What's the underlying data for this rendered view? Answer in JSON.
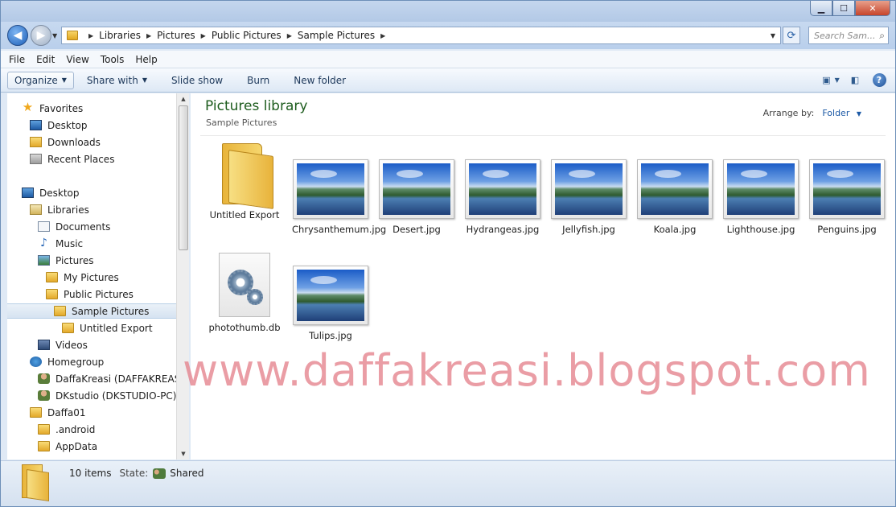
{
  "addressbar": {
    "breadcrumbs": [
      "Libraries",
      "Pictures",
      "Public Pictures",
      "Sample Pictures"
    ],
    "search_placeholder": "Search Sam..."
  },
  "menu": [
    "File",
    "Edit",
    "View",
    "Tools",
    "Help"
  ],
  "toolbar": {
    "organize": "Organize",
    "share_with": "Share with",
    "slide_show": "Slide show",
    "burn": "Burn",
    "new_folder": "New folder"
  },
  "nav": {
    "favorites": "Favorites",
    "desktop_fav": "Desktop",
    "downloads": "Downloads",
    "recent_places": "Recent Places",
    "desktop": "Desktop",
    "libraries": "Libraries",
    "documents": "Documents",
    "music": "Music",
    "pictures": "Pictures",
    "my_pictures": "My Pictures",
    "public_pictures": "Public Pictures",
    "sample_pictures": "Sample Pictures",
    "untitled_export": "Untitled Export",
    "videos": "Videos",
    "homegroup": "Homegroup",
    "user1": "DaffaKreasi (DAFFAKREASI-P",
    "user2": "DKstudio (DKSTUDIO-PC)",
    "daffa01": "Daffa01",
    "android": ".android",
    "appdata": "AppData"
  },
  "content": {
    "library_title": "Pictures library",
    "library_subtitle": "Sample Pictures",
    "arrange_by_label": "Arrange by:",
    "arrange_by_value": "Folder",
    "items": [
      {
        "name": "Untitled Export",
        "type": "folder"
      },
      {
        "name": "Chrysanthemum.jpg",
        "type": "image"
      },
      {
        "name": "Desert.jpg",
        "type": "image"
      },
      {
        "name": "Hydrangeas.jpg",
        "type": "image"
      },
      {
        "name": "Jellyfish.jpg",
        "type": "image"
      },
      {
        "name": "Koala.jpg",
        "type": "image"
      },
      {
        "name": "Lighthouse.jpg",
        "type": "image"
      },
      {
        "name": "Penguins.jpg",
        "type": "image"
      },
      {
        "name": "photothumb.db",
        "type": "file"
      },
      {
        "name": "Tulips.jpg",
        "type": "image"
      }
    ]
  },
  "watermark": "www.daffakreasi.blogspot.com",
  "statusbar": {
    "count": "10 items",
    "state_label": "State:",
    "state_value": "Shared"
  }
}
